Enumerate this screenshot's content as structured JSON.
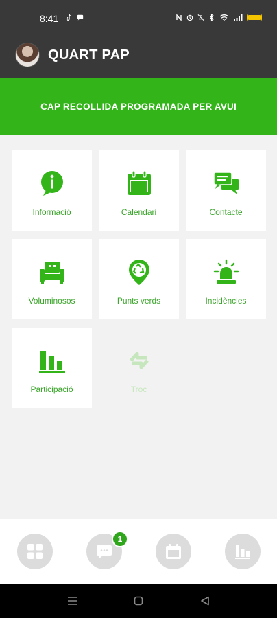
{
  "status_bar": {
    "time": "8:41",
    "icons_left": [
      "tiktok-icon",
      "chat-icon"
    ],
    "icons_right": [
      "nfc-icon",
      "alarm-icon",
      "mute-icon",
      "bluetooth-icon",
      "wifi-icon",
      "signal-icon",
      "battery-icon"
    ]
  },
  "header": {
    "title": "QUART PAP",
    "avatar": "user-avatar"
  },
  "banner": {
    "text": "CAP RECOLLIDA PROGRAMADA PER AVUI"
  },
  "tiles": [
    {
      "label": "Informació",
      "icon": "info-icon",
      "enabled": true
    },
    {
      "label": "Calendari",
      "icon": "calendar-icon",
      "enabled": true
    },
    {
      "label": "Contacte",
      "icon": "chat-bubbles-icon",
      "enabled": true
    },
    {
      "label": "Voluminosos",
      "icon": "sofa-icon",
      "enabled": true
    },
    {
      "label": "Punts verds",
      "icon": "recycle-pin-icon",
      "enabled": true
    },
    {
      "label": "Incidències",
      "icon": "siren-icon",
      "enabled": true
    },
    {
      "label": "Participació",
      "icon": "bar-chart-icon",
      "enabled": true
    },
    {
      "label": "Troc",
      "icon": "exchange-icon",
      "enabled": false
    }
  ],
  "bottom_nav": {
    "items": [
      "grid-icon",
      "message-icon",
      "calendar-icon",
      "bar-chart-icon"
    ],
    "message_badge": "1"
  },
  "colors": {
    "brand_green": "#33b51a",
    "header_dark": "#393939",
    "tile_label_green": "#3aa52a"
  }
}
